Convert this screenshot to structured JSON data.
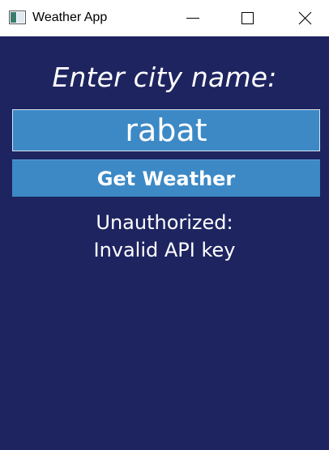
{
  "window": {
    "title": "Weather App",
    "icon": "app-window-icon",
    "controls": {
      "minimize_icon": "minimize-icon",
      "maximize_icon": "maximize-icon",
      "close_icon": "close-icon"
    }
  },
  "main": {
    "prompt": "Enter city name:",
    "city_input": {
      "value": "rabat",
      "placeholder": ""
    },
    "get_weather_label": "Get Weather",
    "status_lines": [
      "Unauthorized:",
      "Invalid API key"
    ]
  },
  "colors": {
    "background": "#1e2460",
    "accent": "#3c89c6",
    "text": "#ffffff"
  }
}
